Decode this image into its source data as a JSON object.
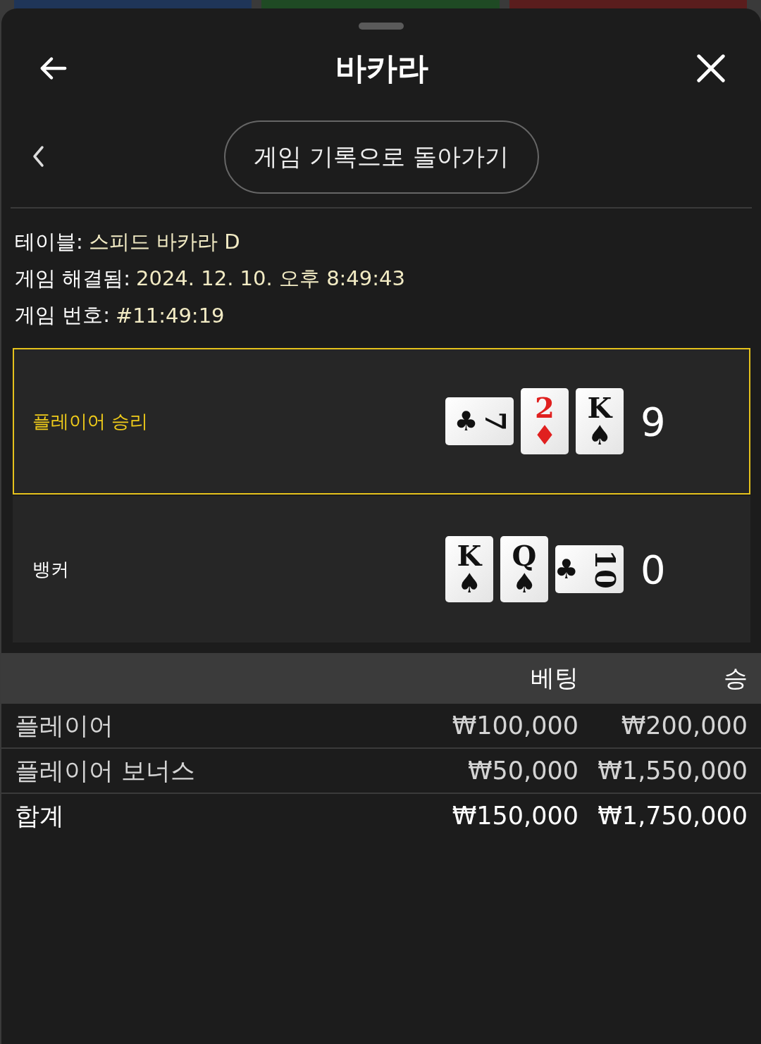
{
  "background_tiles": [
    {
      "color": "#1f3558"
    },
    {
      "color": "#1f4a24"
    },
    {
      "color": "#5a1d1d"
    }
  ],
  "header": {
    "title": "바카라"
  },
  "back_button": {
    "label": "게임 기록으로 돌아가기"
  },
  "info": [
    {
      "label": "테이블:",
      "value": "스피드 바카라 D"
    },
    {
      "label": "게임 해결됨:",
      "value": "2024. 12. 10. 오후 8:49:43"
    },
    {
      "label": "게임 번호:",
      "value": "#11:49:19"
    }
  ],
  "hands": [
    {
      "label": "플레이어 승리",
      "winner": true,
      "score": "9",
      "cards": [
        {
          "rank": "7",
          "suit": "♣",
          "color": "#111111",
          "sideways": true
        },
        {
          "rank": "2",
          "suit": "♦",
          "color": "#e0201f",
          "sideways": false
        },
        {
          "rank": "K",
          "suit": "♠",
          "color": "#111111",
          "sideways": false
        }
      ]
    },
    {
      "label": "뱅커",
      "winner": false,
      "score": "0",
      "cards": [
        {
          "rank": "K",
          "suit": "♠",
          "color": "#111111",
          "sideways": false
        },
        {
          "rank": "Q",
          "suit": "♠",
          "color": "#111111",
          "sideways": false
        },
        {
          "rank": "10",
          "suit": "♣",
          "color": "#111111",
          "sideways": true
        }
      ]
    }
  ],
  "bets": {
    "columns": [
      "베팅",
      "승"
    ],
    "rows": [
      {
        "name": "플레이어",
        "bet": "₩100,000",
        "win": "₩200,000",
        "kind": "item"
      },
      {
        "name": "플레이어 보너스",
        "bet": "₩50,000",
        "win": "₩1,550,000",
        "kind": "item"
      },
      {
        "name": "합계",
        "bet": "₩150,000",
        "win": "₩1,750,000",
        "kind": "total"
      }
    ]
  }
}
